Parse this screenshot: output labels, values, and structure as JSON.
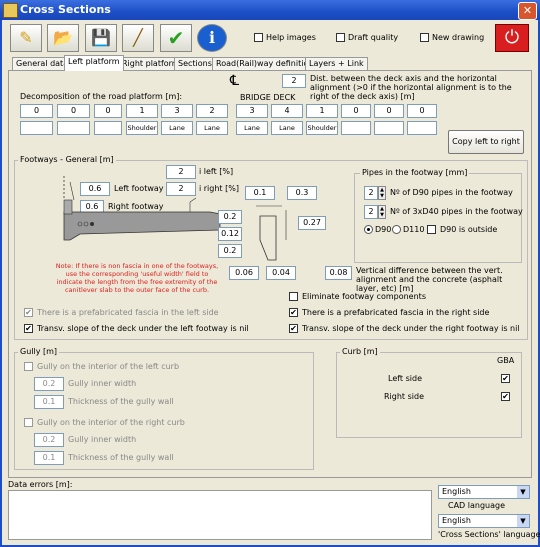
{
  "window": {
    "title": "Cross Sections"
  },
  "toolbar": {
    "buttons": [
      {
        "name": "edit",
        "glyph": "✎"
      },
      {
        "name": "open",
        "glyph": "📂"
      },
      {
        "name": "save",
        "glyph": "💾"
      },
      {
        "name": "draw",
        "glyph": "╱"
      },
      {
        "name": "check",
        "glyph": "✔"
      },
      {
        "name": "info",
        "glyph": "ℹ"
      }
    ],
    "help_images": "Help images",
    "draft_quality": "Draft quality",
    "new_drawing": "New drawing",
    "exit_glyph": "⏻"
  },
  "tabs": [
    "General data",
    "Left platform",
    "Right platform",
    "Sections",
    "Road(Rail)way definition",
    "Layers + Link"
  ],
  "active_tab": "Left platform",
  "platform": {
    "dist_value": "2",
    "dist_label": "Dist. between the deck axis and the horizontal alignment (>0 if the horizontal alignment is to the right of the deck axis) [m]",
    "decomp_label": "Decomposition of the road platform [m]:",
    "bridge_deck": "BRIDGE DECK",
    "left_values": [
      "0",
      "0",
      "0",
      "1",
      "3",
      "2"
    ],
    "left_types": [
      "",
      "",
      "",
      "Shoulder",
      "Lane",
      "Lane"
    ],
    "right_values": [
      "3",
      "4",
      "1",
      "0",
      "0",
      "0"
    ],
    "right_types": [
      "Lane",
      "Lane",
      "Shoulder",
      "",
      "",
      ""
    ],
    "copy_button": "Copy left to right"
  },
  "footways": {
    "title": "Footways - General [m]",
    "i_left_value": "2",
    "i_left_label": "i left [%]",
    "i_right_value": "2",
    "i_right_label": "i right [%]",
    "left_footway_value": "0.6",
    "left_footway_label": "Left footway",
    "right_footway_value": "0.6",
    "right_footway_label": "Right footway",
    "dim_a": "0.1",
    "dim_b": "0.3",
    "dim_c": "0.2",
    "dim_d": "0.12",
    "dim_e": "0.2",
    "dim_f": "0.27",
    "dim_g": "0.06",
    "dim_h": "0.04",
    "vert_diff_value": "0.08",
    "vert_diff_label": "Vertical difference between the vert. alignment and the concrete (asphalt layer, etc) [m]",
    "note": "Note: If there is non fascia in one of the footways, use the corresponding 'useful width' field to indicate the length from the free extremity of the canitlever slab to the outer face of the curb.",
    "eliminate_label": "Eliminate footway components",
    "fascia_left_label": "There is a prefabricated fascia in the left side",
    "fascia_right_label": "There is a prefabricated fascia in the right side",
    "slope_left_label": "Transv. slope of the deck under the left footway is nil",
    "slope_right_label": "Transv. slope of the deck under the right footway is nil"
  },
  "pipes": {
    "title": "Pipes in the footway [mm]",
    "d90_count": "2",
    "d90_label": "Nº of D90 pipes in the footway",
    "d40_count": "2",
    "d40_label": "Nº of 3xD40 pipes in the footway",
    "opt_d90": "D90",
    "opt_d110": "D110",
    "outside_label": "D90 is outside"
  },
  "gully": {
    "title": "Gully [m]",
    "left_label": "Gully on the interior of the left curb",
    "left_width_value": "0.2",
    "left_width_label": "Gully inner width",
    "left_thick_value": "0.1",
    "left_thick_label": "Thickness of the gully wall",
    "right_label": "Gully on the interior of the right curb",
    "right_width_value": "0.2",
    "right_width_label": "Gully inner width",
    "right_thick_value": "0.1",
    "right_thick_label": "Thickness of the gully wall"
  },
  "curb": {
    "title": "Curb [m]",
    "gba": "GBA",
    "left_side": "Left side",
    "right_side": "Right side"
  },
  "footer": {
    "errors_label": "Data errors [m]:",
    "cad_lang_value": "English",
    "cad_lang_label": "CAD language",
    "cs_lang_value": "English",
    "cs_lang_label": "'Cross Sections' language"
  }
}
